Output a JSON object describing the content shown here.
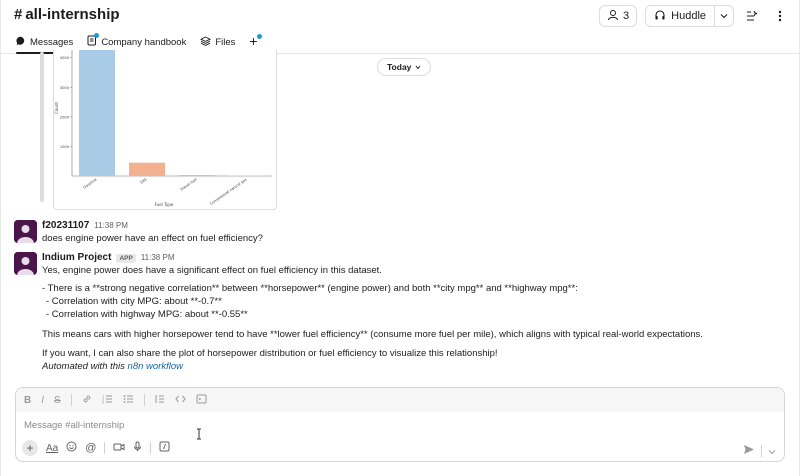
{
  "header": {
    "channel_name": "all-internship",
    "members_count": "3",
    "huddle_label": "Huddle"
  },
  "tabs": [
    {
      "label": "Messages"
    },
    {
      "label": "Company handbook"
    },
    {
      "label": "Files"
    }
  ],
  "date_divider": "Today",
  "chart_data": {
    "type": "bar",
    "categories": [
      "Gasoline",
      "E85",
      "Diesel fuel",
      "Compressed natural gas"
    ],
    "values": [
      4300,
      450,
      30,
      10
    ],
    "xlabel": "Fuel Type",
    "ylabel": "Count",
    "yticks": [
      "1000",
      "2000",
      "3000",
      "4000"
    ],
    "colors": [
      "#a8cbe6",
      "#f2b08e",
      "#9fd29f",
      "#dddddd"
    ]
  },
  "messages": [
    {
      "sender": "f20231107",
      "time": "11:38 PM",
      "lines": [
        "does engine power have an effect on fuel efficiency?"
      ]
    },
    {
      "sender": "Indium Project",
      "badge": "APP",
      "time": "11:38 PM",
      "intro": "Yes, engine power does have a significant effect on fuel efficiency in this dataset.",
      "bullet_main": "- There is a **strong negative correlation** between **horsepower** (engine power) and both **city mpg** and **highway mpg**:",
      "bullet_city": "- Correlation with city MPG: about **-0.7**",
      "bullet_highway": "- Correlation with highway MPG: about **-0.55**",
      "explanation": "This means cars with higher horsepower tend to have **lower fuel efficiency** (consume more fuel per mile), which aligns with typical real-world expectations.",
      "offer": "If you want, I can also share the plot of horsepower distribution or fuel efficiency to visualize this relationship!",
      "automated_prefix": "Automated with this ",
      "automated_link": "n8n workflow"
    }
  ],
  "composer": {
    "placeholder": "Message #all-internship"
  }
}
